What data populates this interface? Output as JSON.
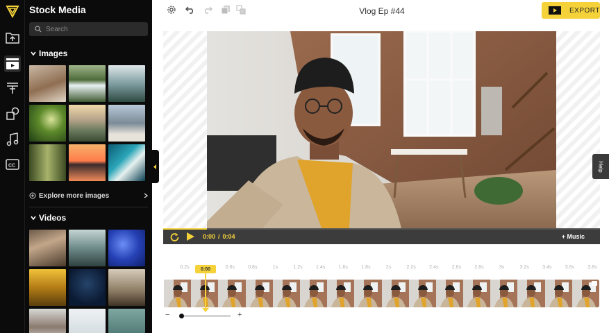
{
  "rail": {
    "items": [
      {
        "icon": "folder-upload-icon"
      },
      {
        "icon": "stock-media-icon",
        "active": true
      },
      {
        "icon": "text-icon"
      },
      {
        "icon": "elements-icon"
      },
      {
        "icon": "music-note-icon"
      },
      {
        "icon": "cc-subtitles-icon"
      }
    ]
  },
  "panel": {
    "title": "Stock Media",
    "search_placeholder": "Search",
    "images": {
      "heading": "Images",
      "thumbs": [
        {
          "name": "woman-rock-thumb",
          "bg": "linear-gradient(160deg,#c9b8a4,#8f6e52 55%,#e2d7c8)"
        },
        {
          "name": "waterfall-thumb",
          "bg": "linear-gradient(180deg,#9fb58a,#4e6b3a 40%,#e8f0f2 55%,#3f5b31)"
        },
        {
          "name": "misty-forest-thumb",
          "bg": "linear-gradient(180deg,#dfe7ea,#7f9ea1 50%,#2f4a43)"
        },
        {
          "name": "green-canopy-thumb",
          "bg": "radial-gradient(circle at 60% 40%,#d9e39a,#5e8a2b 40%,#203d15)"
        },
        {
          "name": "mountain-valley-thumb",
          "bg": "linear-gradient(180deg,#f0d8a8,#b7a48b 40%,#6a7a5d 70%,#3b4a32)"
        },
        {
          "name": "hiker-peak-thumb",
          "bg": "linear-gradient(180deg,#b9c8d8,#7b8b97 50%,#e7e2da 80%)"
        },
        {
          "name": "forest-path-thumb",
          "bg": "linear-gradient(90deg,#3c4a22,#a7b36b 50%,#3c4a22)"
        },
        {
          "name": "sunset-lake-thumb",
          "bg": "linear-gradient(180deg,#f6b16b,#ff7c4a 45%,#3a2a2c 55%,#f08a57)"
        },
        {
          "name": "ocean-aerial-thumb",
          "bg": "linear-gradient(135deg,#0d5b73,#2aa5b8 40%,#e7f1ef 60%,#0a3f52)"
        }
      ],
      "explore": "Explore more images"
    },
    "videos": {
      "heading": "Videos",
      "thumbs": [
        {
          "name": "sand-ripples-thumb",
          "bg": "linear-gradient(160deg,#6c5a4a,#c3a78a 40%,#4a3a2c)"
        },
        {
          "name": "river-rocks-thumb",
          "bg": "linear-gradient(180deg,#c5d6d4,#6e8a8a 50%,#2f4240)"
        },
        {
          "name": "blue-bokeh-thumb",
          "bg": "radial-gradient(circle at 40% 40%,#6b8df5,#2641b5 50%,#0f1f6a)"
        },
        {
          "name": "autumn-trees-thumb",
          "bg": "linear-gradient(180deg,#f0c23a,#b37c16 50%,#5a3e0c)"
        },
        {
          "name": "night-sky-thumb",
          "bg": "radial-gradient(circle at 50% 40%,#25446a,#0b1a33 70%)"
        },
        {
          "name": "bird-branch-thumb",
          "bg": "linear-gradient(180deg,#d6cbb9,#8b7a62 60%,#3f3325)"
        },
        {
          "name": "snowy-rocks-thumb",
          "bg": "linear-gradient(180deg,#d8d8d6,#8a7a6e 50%,#f1f1ef)"
        },
        {
          "name": "white-sky-thumb",
          "bg": "linear-gradient(180deg,#eef2f4,#c9d3d8)"
        },
        {
          "name": "teal-water-thumb",
          "bg": "linear-gradient(180deg,#7fa7a2,#3d6863)"
        }
      ]
    }
  },
  "toolbar": {
    "project_title": "Vlog Ep #44",
    "export_label": "EXPORT"
  },
  "player": {
    "current_time": "0:00",
    "separator": "/",
    "duration": "0:04",
    "music_label": "+ Music",
    "progress": 0.1
  },
  "timeline": {
    "ticks": [
      "0.2s",
      "0.4s",
      "0.6s",
      "0.8s",
      "1s",
      "1.2s",
      "1.4s",
      "1.6s",
      "1.8s",
      "2s",
      "2.2s",
      "2.4s",
      "2.6s",
      "2.8s",
      "3s",
      "3.2s",
      "3.4s",
      "3.6s",
      "3.8s"
    ],
    "playhead_label": "0:00",
    "zoom_minus": "−",
    "zoom_plus": "+",
    "zoom_level": 0.0
  },
  "help_label": "Help",
  "colors": {
    "accent": "#f5d23a",
    "panel_bg": "#0b0b0b",
    "controls_bg": "#3c3c3c"
  }
}
